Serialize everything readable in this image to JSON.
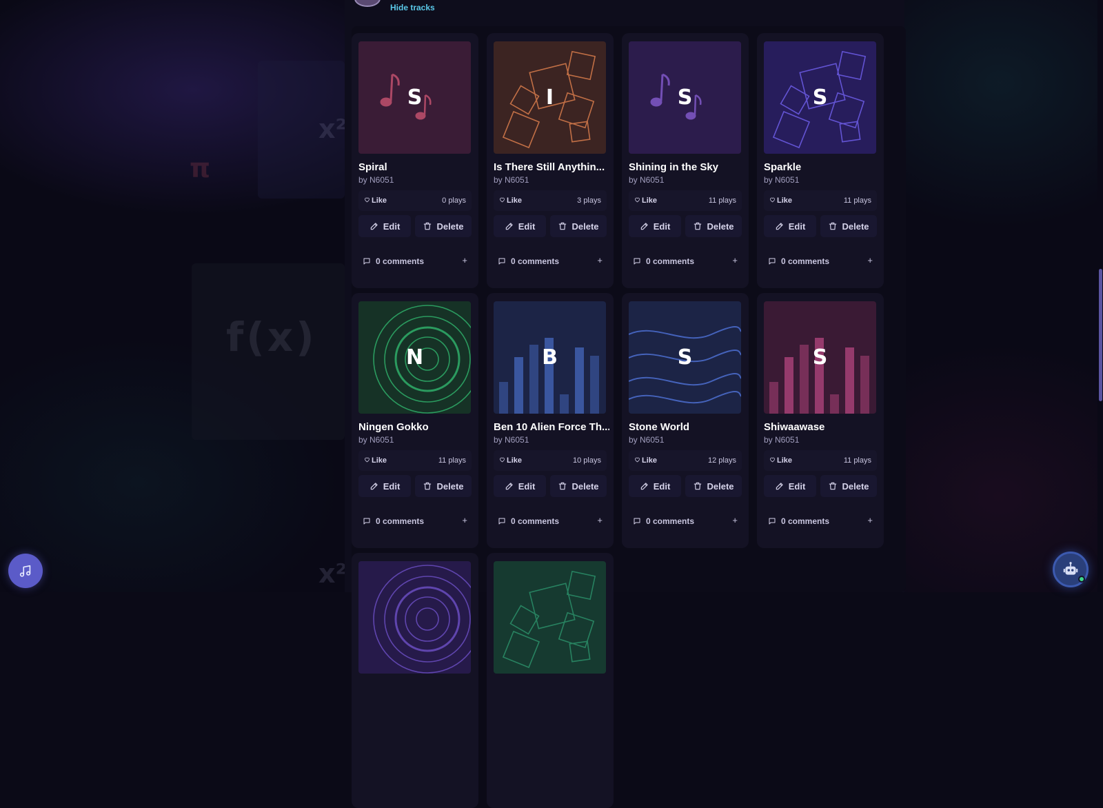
{
  "header": {
    "hide_tracks_label": "Hide tracks"
  },
  "tracks": [
    {
      "title": "Spiral",
      "artist": "by N6051",
      "letter": "S",
      "plays": "0 plays",
      "like": "Like",
      "edit": "Edit",
      "delete": "Delete",
      "comments": "0 comments",
      "add": "+",
      "cover_style": "notes",
      "cover_color": "#3a1c36",
      "accent": "#c0506e"
    },
    {
      "title": "Is There Still Anythin...",
      "artist": "by N6051",
      "letter": "I",
      "plays": "3 plays",
      "like": "Like",
      "edit": "Edit",
      "delete": "Delete",
      "comments": "0 comments",
      "add": "+",
      "cover_style": "squares",
      "cover_color": "#3c2422",
      "accent": "#d0784a"
    },
    {
      "title": "Shining in the Sky",
      "artist": "by N6051",
      "letter": "S",
      "plays": "11 plays",
      "like": "Like",
      "edit": "Edit",
      "delete": "Delete",
      "comments": "0 comments",
      "add": "+",
      "cover_style": "notes",
      "cover_color": "#2c1c4c",
      "accent": "#8058c8"
    },
    {
      "title": "Sparkle",
      "artist": "by N6051",
      "letter": "S",
      "plays": "11 plays",
      "like": "Like",
      "edit": "Edit",
      "delete": "Delete",
      "comments": "0 comments",
      "add": "+",
      "cover_style": "squares",
      "cover_color": "#271d5c",
      "accent": "#6a5ae0"
    },
    {
      "title": "Ningen Gokko",
      "artist": "by N6051",
      "letter": "N",
      "plays": "11 plays",
      "like": "Like",
      "edit": "Edit",
      "delete": "Delete",
      "comments": "0 comments",
      "add": "+",
      "cover_style": "rings",
      "cover_color": "#163226",
      "accent": "#2fae6a"
    },
    {
      "title": "Ben 10 Alien Force Th...",
      "artist": "by N6051",
      "letter": "B",
      "plays": "10 plays",
      "like": "Like",
      "edit": "Edit",
      "delete": "Delete",
      "comments": "0 comments",
      "add": "+",
      "cover_style": "bars",
      "cover_color": "#1c2446",
      "accent": "#3e5ca8"
    },
    {
      "title": "Stone World",
      "artist": "by N6051",
      "letter": "S",
      "plays": "12 plays",
      "like": "Like",
      "edit": "Edit",
      "delete": "Delete",
      "comments": "0 comments",
      "add": "+",
      "cover_style": "waves",
      "cover_color": "#1c2446",
      "accent": "#4a6ac8"
    },
    {
      "title": "Shiwaawase",
      "artist": "by N6051",
      "letter": "S",
      "plays": "11 plays",
      "like": "Like",
      "edit": "Edit",
      "delete": "Delete",
      "comments": "0 comments",
      "add": "+",
      "cover_style": "bars",
      "cover_color": "#3a1a34",
      "accent": "#a03e72"
    }
  ],
  "partial_covers": [
    {
      "cover_style": "rings",
      "cover_color": "#261a4a",
      "accent": "#6a4ec0"
    },
    {
      "cover_style": "squares",
      "cover_color": "#163a30",
      "accent": "#2a8a66"
    }
  ],
  "background_symbols": {
    "fx": "f(x)",
    "pi": "π",
    "x1": "x²",
    "x2": "x²"
  },
  "icons": {
    "music": "music-note-icon",
    "assistant": "robot-assistant-icon",
    "heart": "heart-icon",
    "pencil": "pencil-icon",
    "trash": "trash-icon",
    "comment": "comment-icon"
  }
}
